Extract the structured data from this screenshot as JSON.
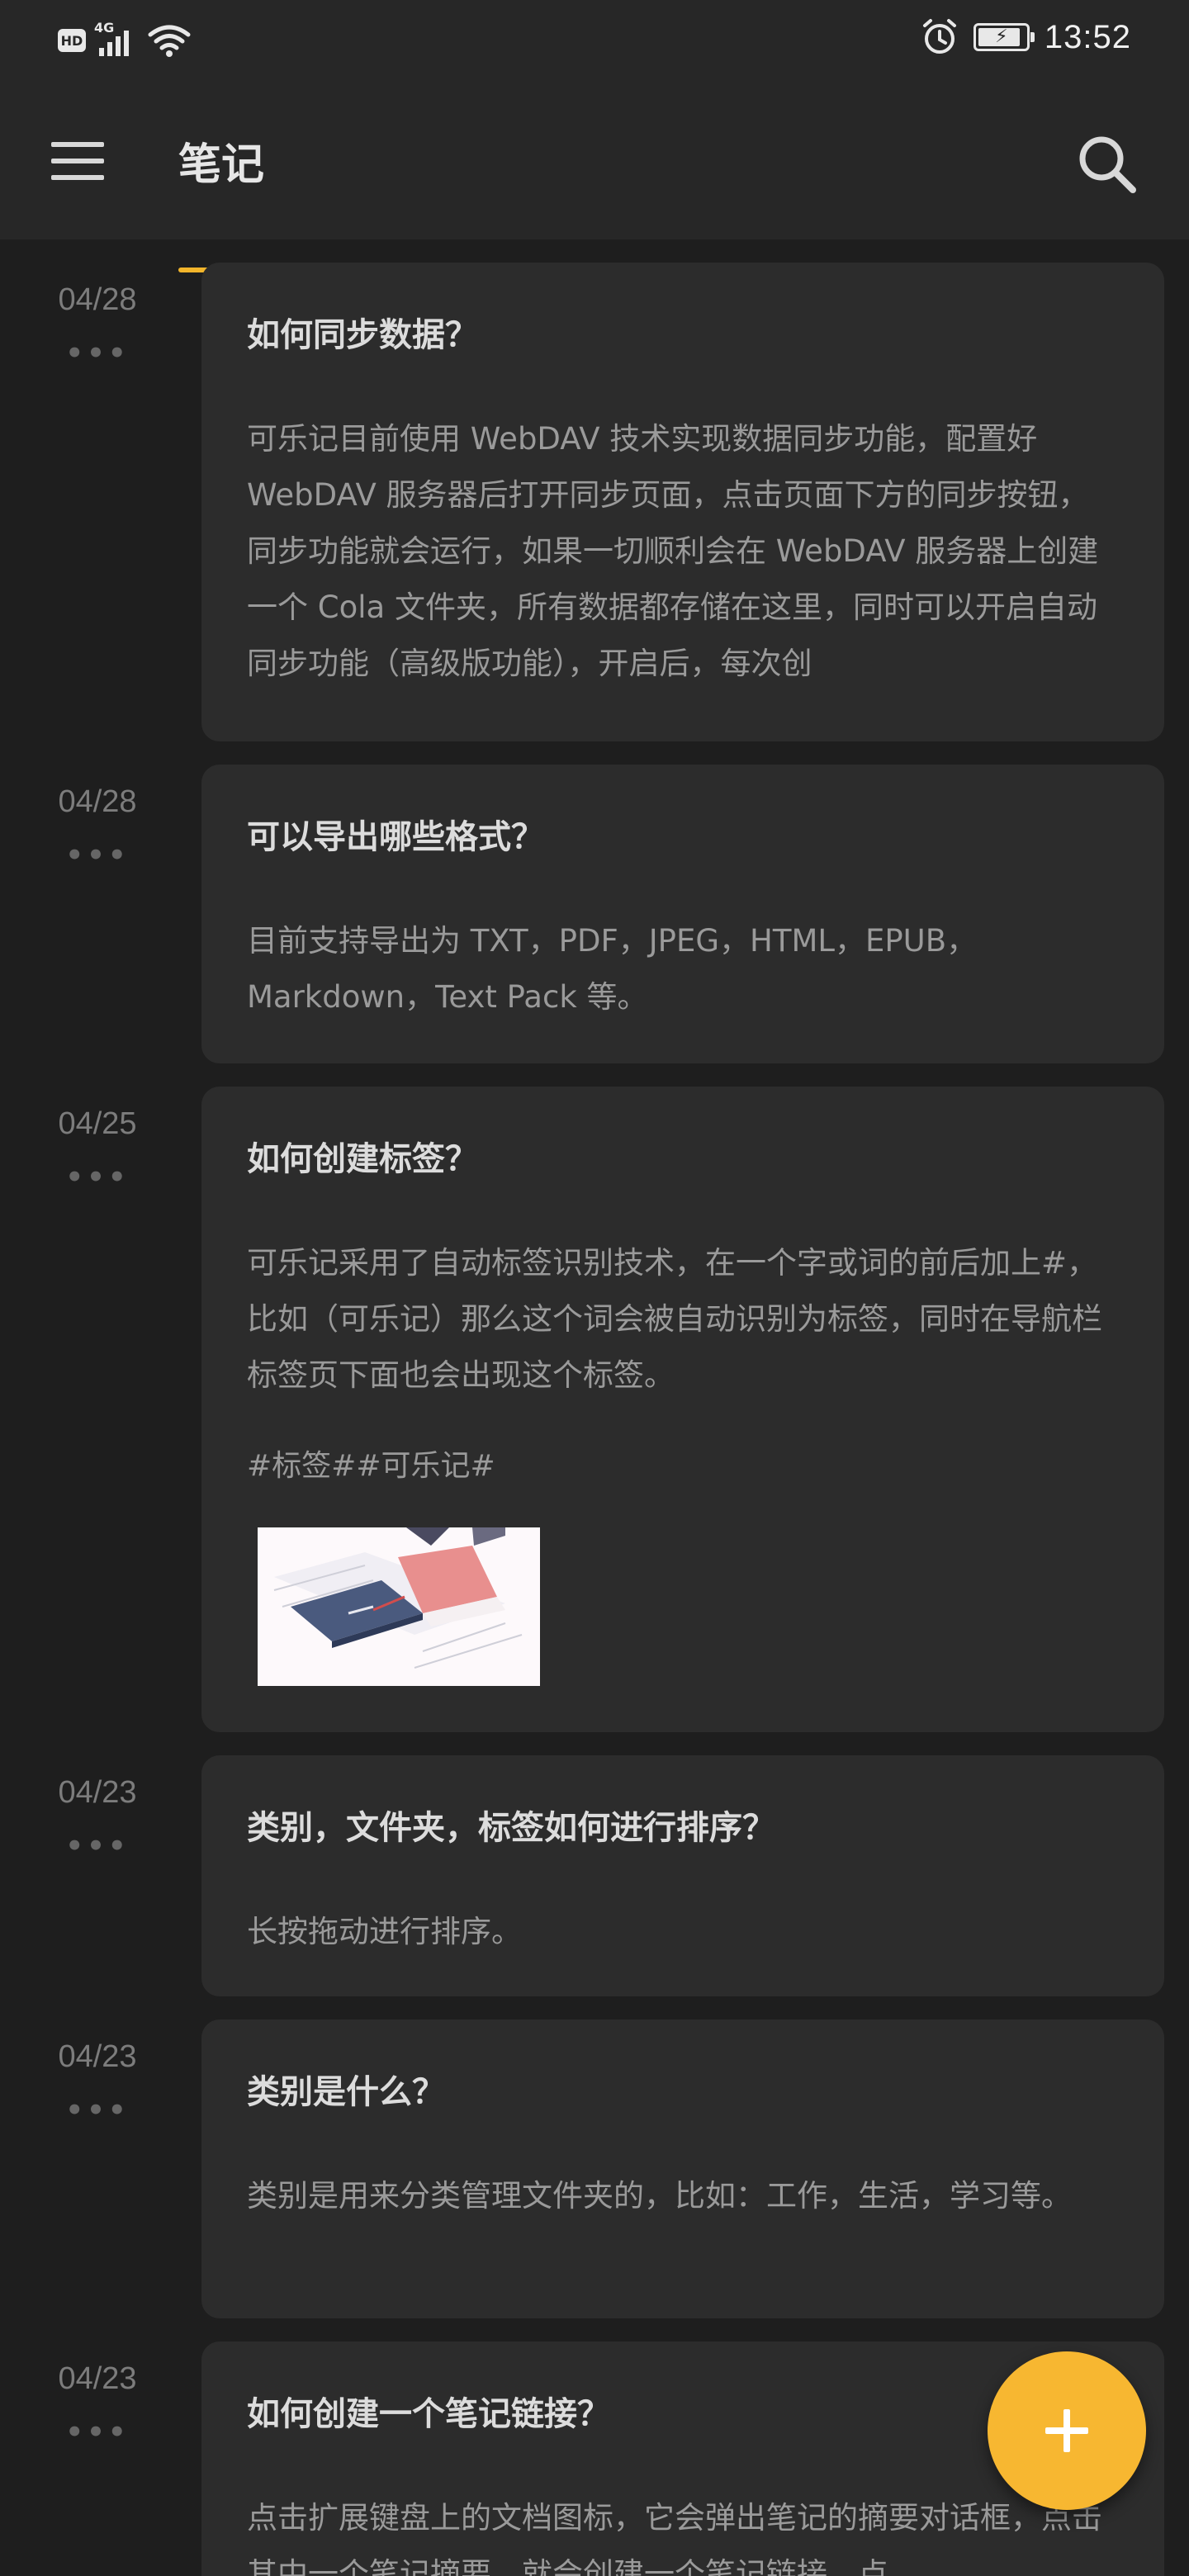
{
  "status_bar": {
    "hd_label": "HD",
    "network_label": "4G",
    "time": "13:52",
    "battery_level": 0.9,
    "icons": [
      "hd-icon",
      "signal-icon",
      "wifi-icon",
      "alarm-icon",
      "battery-charging-icon"
    ]
  },
  "app_bar": {
    "title": "笔记",
    "accent_color": "#f2b52b",
    "menu_icon": "menu-icon",
    "search_icon": "search-icon"
  },
  "notes": [
    {
      "date": "04/28",
      "more": "•••",
      "title": "如何同步数据？",
      "body": "可乐记目前使用 WebDAV 技术实现数据同步功能，配置好 WebDAV 服务器后打开同步页面，点击页面下方的同步按钮，同步功能就会运行，如果一切顺利会在 WebDAV 服务器上创建一个 Cola 文件夹，所有数据都存储在这里，同时可以开启自动同步功能（高级版功能），开启后，每次创"
    },
    {
      "date": "04/28",
      "more": "•••",
      "title": "可以导出哪些格式？",
      "body": "目前支持导出为 TXT，PDF，JPEG，HTML，EPUB，Markdown，Text Pack 等。"
    },
    {
      "date": "04/25",
      "more": "•••",
      "title": "如何创建标签？",
      "body": "可乐记采用了自动标签识别技术，在一个字或词的前后加上#，比如（可乐记）那么这个词会被自动识别为标签，同时在导航栏标签页下面也会出现这个标签。",
      "tags": "#标签##可乐记#",
      "image": "notebook-illustration"
    },
    {
      "date": "04/23",
      "more": "•••",
      "title": "类别，文件夹，标签如何进行排序？",
      "body": "长按拖动进行排序。"
    },
    {
      "date": "04/23",
      "more": "•••",
      "title": "类别是什么？",
      "body": "类别是用来分类管理文件夹的，比如：工作，生活，学习等。"
    },
    {
      "date": "04/23",
      "more": "•••",
      "title": "如何创建一个笔记链接？",
      "body": "点击扩展键盘上的文档图标，它会弹出笔记的摘要对话框，点击其中一个笔记摘要，就会创建一个笔记链接，点"
    }
  ],
  "fab": {
    "icon": "plus-icon",
    "color": "#f7b731"
  }
}
